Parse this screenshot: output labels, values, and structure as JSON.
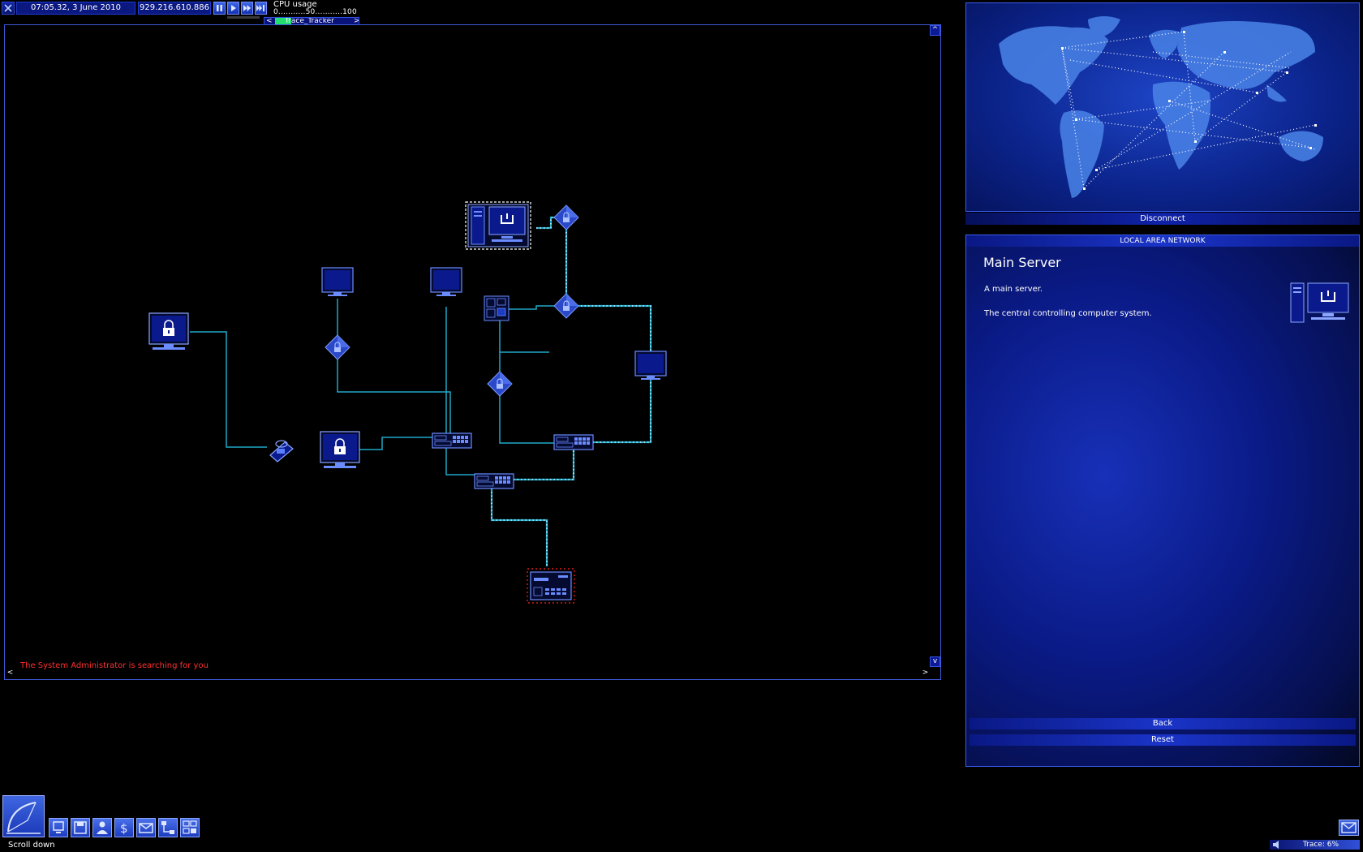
{
  "topbar": {
    "datetime": "07:05.32, 3 June 2010",
    "ip": "929.216.610.886",
    "cpu_label": "CPU usage",
    "cpu_scale": "0...........50...........100",
    "tracker_prev": "<",
    "tracker_label": "Trace_Tracker",
    "tracker_next": ">"
  },
  "lan": {
    "warning": "The System Administrator is searching for you",
    "scroll_up": "^",
    "scroll_down": "v",
    "scroll_left": "<",
    "scroll_right": ">"
  },
  "map": {
    "disconnect_label": "Disconnect"
  },
  "info": {
    "header": "LOCAL AREA NETWORK",
    "title": "Main Server",
    "subtitle": "A main server.",
    "description": "The central controlling computer system.",
    "back_label": "Back",
    "reset_label": "Reset"
  },
  "status": {
    "text": "Scroll down",
    "trace": "Trace: 6%"
  },
  "colors": {
    "wire": "#1fa8c8",
    "active_wire": "#7fe9ff",
    "node": "#5a80ff",
    "warning": "#ff3030"
  }
}
